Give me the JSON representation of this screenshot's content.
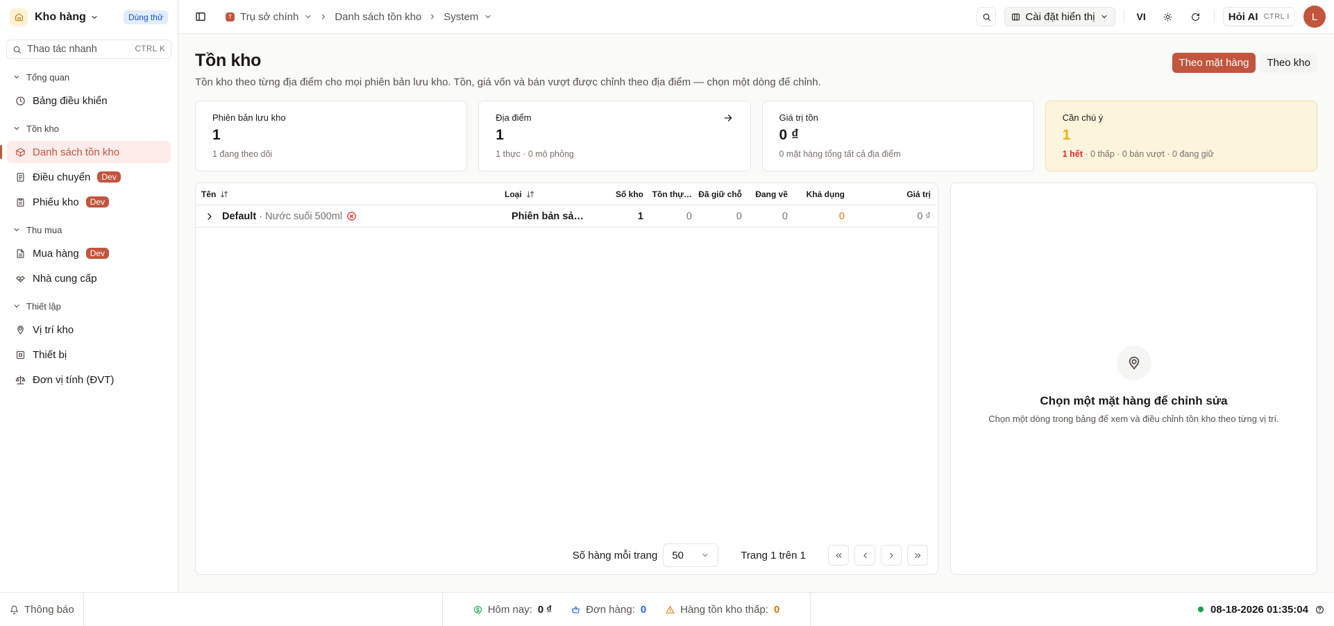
{
  "app": {
    "name": "Kho hàng",
    "trial_badge": "Dùng thử"
  },
  "quick_action": {
    "label": "Thao tác nhanh",
    "shortcut": "CTRL K"
  },
  "sidebar": {
    "groups": [
      {
        "label": "Tổng quan",
        "items": [
          {
            "label": "Bảng điều khiển",
            "icon": "dashboard-icon"
          }
        ]
      },
      {
        "label": "Tồn kho",
        "items": [
          {
            "label": "Danh sách tồn kho",
            "icon": "box-icon",
            "active": true
          },
          {
            "label": "Điều chuyển",
            "icon": "transfer-icon",
            "badge": "Dev"
          },
          {
            "label": "Phiếu kho",
            "icon": "clipboard-icon",
            "badge": "Dev"
          }
        ]
      },
      {
        "label": "Thu mua",
        "items": [
          {
            "label": "Mua hàng",
            "icon": "file-icon",
            "badge": "Dev"
          },
          {
            "label": "Nhà cung cấp",
            "icon": "handshake-icon"
          }
        ]
      },
      {
        "label": "Thiết lập",
        "items": [
          {
            "label": "Vị trí kho",
            "icon": "location-icon"
          },
          {
            "label": "Thiết bị",
            "icon": "device-icon"
          },
          {
            "label": "Đơn vị tính (ĐVT)",
            "icon": "scale-icon"
          }
        ]
      }
    ]
  },
  "topbar": {
    "breadcrumb": {
      "org_initial": "T",
      "org": "Trụ sở chính",
      "page": "Danh sách tồn kho",
      "context": "System"
    },
    "display_settings": "Cài đặt hiển thị",
    "language": "VI",
    "ask_ai": "Hỏi AI",
    "ask_ai_shortcut": "CTRL I",
    "avatar_initial": "L"
  },
  "page": {
    "title": "Tồn kho",
    "subtitle": "Tồn kho theo từng địa điểm cho mọi phiên bản lưu kho. Tồn, giá vốn và bán vượt được chỉnh theo địa điểm — chọn một dòng để chỉnh.",
    "view_toggle": {
      "by_item": "Theo mặt hàng",
      "by_warehouse": "Theo kho"
    }
  },
  "stats": {
    "variants": {
      "label": "Phiên bản lưu kho",
      "value": "1",
      "note": "1 đang theo dõi"
    },
    "locations": {
      "label": "Địa điểm",
      "value": "1",
      "note": "1 thực · 0 mô phỏng"
    },
    "stock_value": {
      "label": "Giá trị tồn",
      "value": "0 ₫",
      "note": "0 mặt hàng tổng tất cả địa điểm"
    },
    "attention": {
      "label": "Cần chú ý",
      "value": "1",
      "out_of_stock": "1 hết",
      "rest": " · 0 thấp · 0 bán vượt · 0 đang giữ"
    }
  },
  "table": {
    "columns": {
      "name": "Tên",
      "type": "Loại",
      "count": "Số kho",
      "on_hand": "Tồn thự…",
      "reserved": "Đã giữ chỗ",
      "incoming": "Đang về",
      "available": "Khả dụng",
      "value": "Giá trị"
    },
    "rows": [
      {
        "name": "Default",
        "sub": " · Nước suối 500ml",
        "type": "Phiên bản sả…",
        "count": "1",
        "on_hand": "0",
        "reserved": "0",
        "incoming": "0",
        "available": "0",
        "value": "0 ₫"
      }
    ]
  },
  "pagination": {
    "rows_per_page_label": "Số hàng mỗi trang",
    "rows_per_page": "50",
    "page_info": "Trang 1 trên 1"
  },
  "detail_panel": {
    "title": "Chọn một mặt hàng để chỉnh sửa",
    "subtitle": "Chọn một dòng trong bảng để xem và điều chỉnh tồn kho theo từng vị trí."
  },
  "footer": {
    "notifications": "Thông báo",
    "today_label": "Hôm nay:",
    "today_value": "0 ₫",
    "orders_label": "Đơn hàng:",
    "orders_value": "0",
    "low_stock_label": "Hàng tồn kho thấp:",
    "low_stock_value": "0",
    "datetime": "08-18-2026 01:35:04"
  },
  "colors": {
    "accent": "#c2553d",
    "warning_bg": "#fdf4dc",
    "trial_bg": "#e0edff"
  }
}
